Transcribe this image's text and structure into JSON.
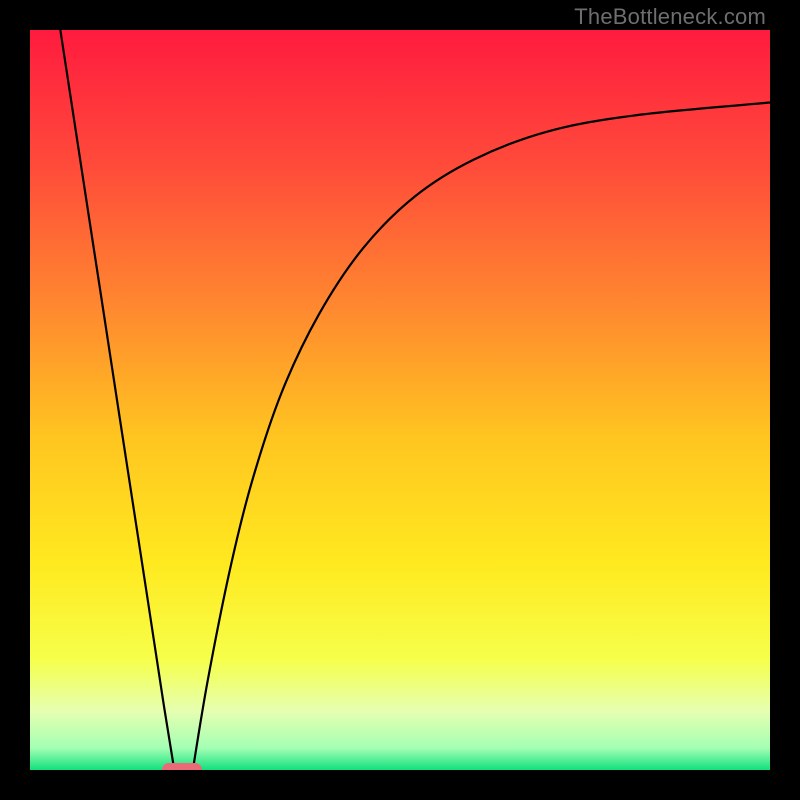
{
  "watermark": "TheBottleneck.com",
  "chart_data": {
    "type": "line",
    "title": "",
    "xlabel": "",
    "ylabel": "",
    "xlim": [
      0,
      100
    ],
    "ylim": [
      0,
      100
    ],
    "grid": false,
    "legend": "none",
    "gradient_stops": [
      {
        "pos": 0.0,
        "color": "#ff1b3f"
      },
      {
        "pos": 0.18,
        "color": "#ff4a3a"
      },
      {
        "pos": 0.38,
        "color": "#ff8a2f"
      },
      {
        "pos": 0.55,
        "color": "#ffc520"
      },
      {
        "pos": 0.72,
        "color": "#ffe91f"
      },
      {
        "pos": 0.85,
        "color": "#f6ff4a"
      },
      {
        "pos": 0.92,
        "color": "#e6ffb0"
      },
      {
        "pos": 0.97,
        "color": "#a4ffb4"
      },
      {
        "pos": 1.0,
        "color": "#12e07e"
      }
    ],
    "series": [
      {
        "name": "left-branch",
        "x": [
          4.1,
          6.0,
          8.0,
          10.0,
          12.0,
          14.0,
          16.0,
          18.0,
          19.5
        ],
        "y": [
          100.0,
          87.6,
          74.5,
          61.5,
          48.4,
          35.4,
          22.4,
          9.3,
          0.0
        ]
      },
      {
        "name": "right-branch",
        "x": [
          22.0,
          24.0,
          27.0,
          30.0,
          34.0,
          39.0,
          45.0,
          52.0,
          60.0,
          70.0,
          82.0,
          100.0
        ],
        "y": [
          0.0,
          12.0,
          27.0,
          39.0,
          51.0,
          61.5,
          70.5,
          77.5,
          82.5,
          86.3,
          88.5,
          90.2
        ]
      }
    ],
    "marker": {
      "name": "optimum-marker",
      "x": 20.5,
      "y": 0.0,
      "color": "#ea6a78"
    }
  }
}
